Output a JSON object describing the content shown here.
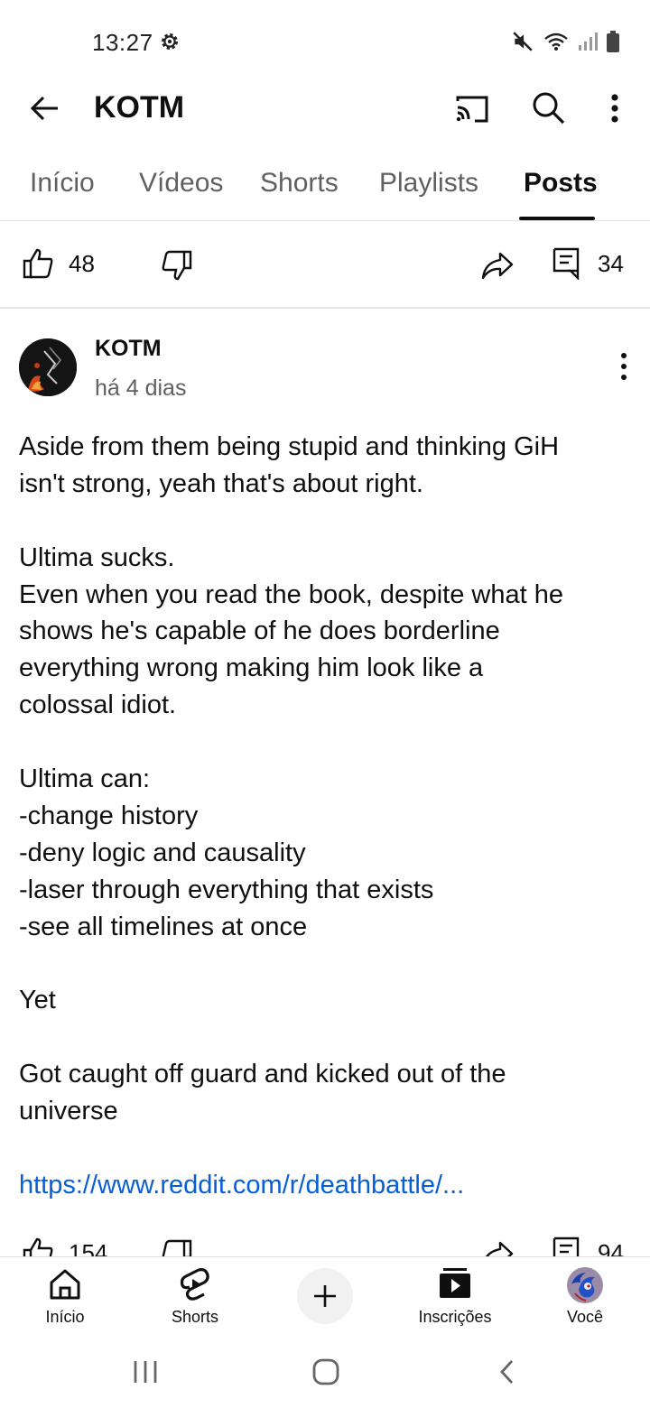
{
  "status_bar": {
    "time": "13:27"
  },
  "app_bar": {
    "title": "KOTM"
  },
  "tabs": [
    {
      "label": "Início"
    },
    {
      "label": "Vídeos"
    },
    {
      "label": "Shorts"
    },
    {
      "label": "Playlists"
    },
    {
      "label": "Posts",
      "active": true
    }
  ],
  "previous_post": {
    "likes": "48",
    "comments": "34"
  },
  "post": {
    "author": "KOTM",
    "time": "há 4 dias",
    "body_lines": [
      "Aside from them being stupid and thinking GiH",
      "isn't strong, yeah that's about right.",
      "",
      "Ultima sucks.",
      "Even when you read the book, despite what he",
      "shows he's capable of he does borderline",
      "everything wrong making him look like a",
      "colossal idiot.",
      "",
      "Ultima can:",
      "-change history",
      "-deny logic and causality",
      "-laser through everything that exists",
      "-see all timelines at once",
      "",
      "Yet",
      "",
      "Got caught off guard and kicked out of the",
      "universe",
      ""
    ],
    "link": "https://www.reddit.com/r/deathbattle/...",
    "likes": "154",
    "comments": "94"
  },
  "bottom_nav": {
    "home": "Início",
    "shorts": "Shorts",
    "subscriptions": "Inscrições",
    "you": "Você"
  },
  "colors": {
    "link": "#065fd4",
    "secondary_text": "#606060"
  }
}
